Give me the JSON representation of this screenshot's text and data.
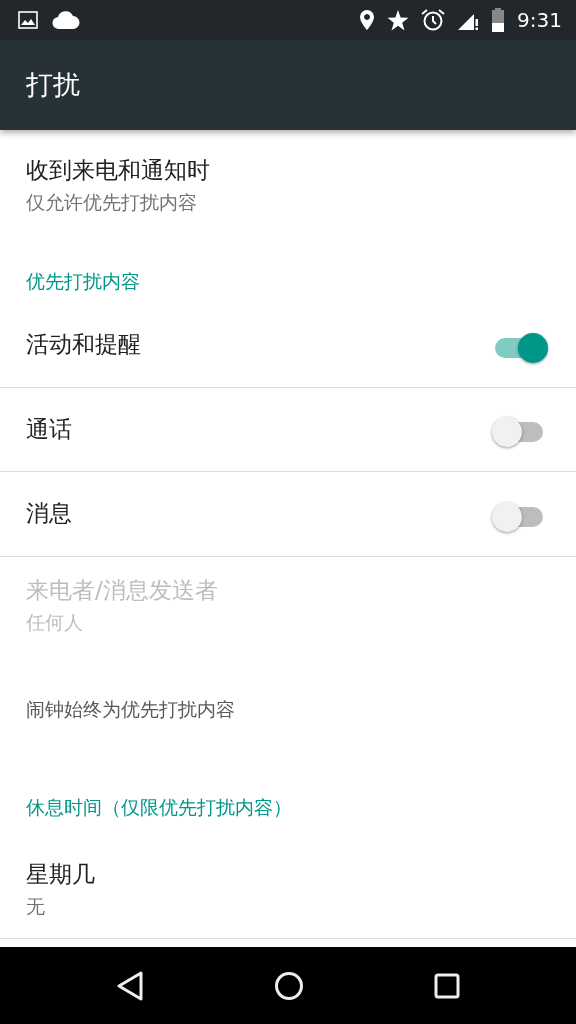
{
  "status_bar": {
    "time": "9:31"
  },
  "app_bar": {
    "title": "打扰"
  },
  "items": [
    {
      "kind": "item",
      "title": "收到来电和通知时",
      "summary": "仅允许优先打扰内容",
      "disabled": false
    },
    {
      "kind": "category",
      "title": "优先打扰内容"
    },
    {
      "kind": "switch",
      "title": "活动和提醒",
      "on": true
    },
    {
      "kind": "switch",
      "title": "通话",
      "on": false
    },
    {
      "kind": "switch",
      "title": "消息",
      "on": false
    },
    {
      "kind": "item",
      "title": "来电者/消息发送者",
      "summary": "任何人",
      "disabled": true
    },
    {
      "kind": "note",
      "title": "闹钟始终为优先打扰内容"
    },
    {
      "kind": "category",
      "title": "休息时间（仅限优先打扰内容）"
    },
    {
      "kind": "item",
      "title": "星期几",
      "summary": "无",
      "disabled": false
    }
  ]
}
